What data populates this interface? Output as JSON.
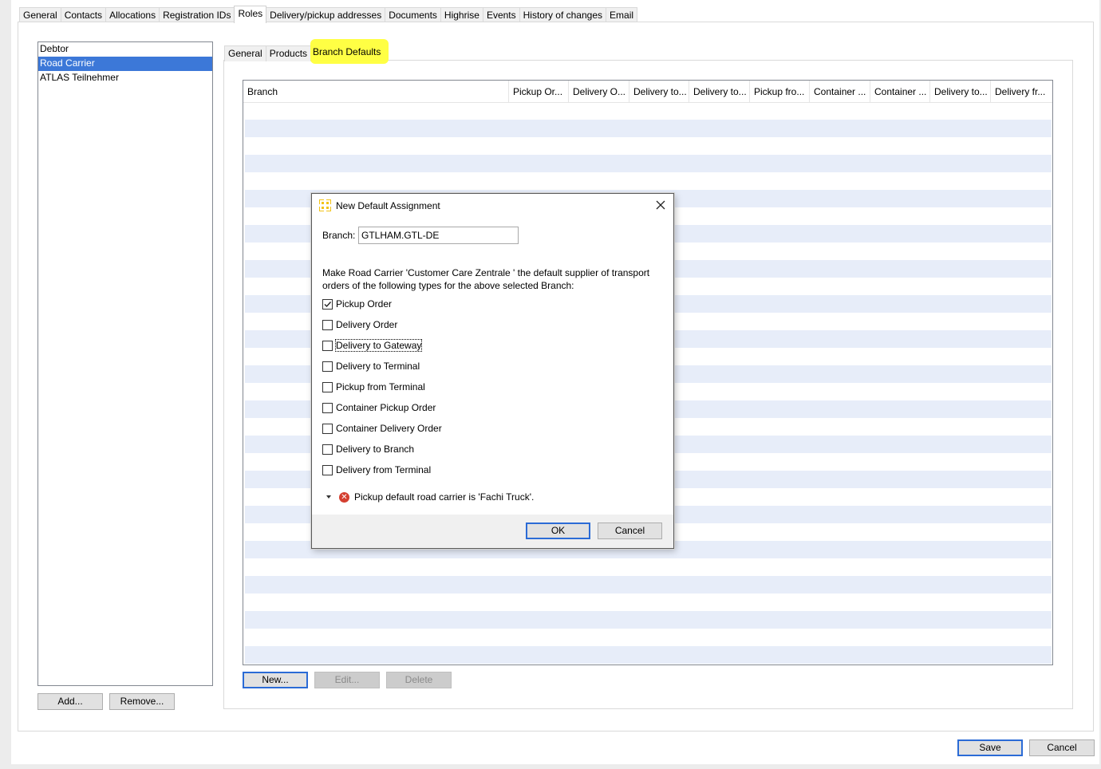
{
  "top_tabs": [
    "General",
    "Contacts",
    "Allocations",
    "Registration IDs",
    "Roles",
    "Delivery/pickup addresses",
    "Documents",
    "Highrise",
    "Events",
    "History of changes",
    "Email"
  ],
  "roles": {
    "items": [
      "Debtor",
      "Road Carrier",
      "ATLAS Teilnehmer"
    ],
    "add_label": "Add...",
    "remove_label": "Remove..."
  },
  "inner_tabs": [
    "General",
    "Products",
    "Branch Defaults"
  ],
  "table": {
    "columns": [
      "Branch",
      "Pickup Or...",
      "Delivery O...",
      "Delivery to...",
      "Delivery to...",
      "Pickup fro...",
      "Container ...",
      "Container ...",
      "Delivery to...",
      "Delivery fr..."
    ],
    "new_label": "New...",
    "edit_label": "Edit...",
    "delete_label": "Delete"
  },
  "dialog": {
    "title": "New Default Assignment",
    "branch_label": "Branch:",
    "branch_value": "GTLHAM.GTL-DE",
    "description": "Make Road Carrier 'Customer Care Zentrale ' the default supplier of transport orders of the following types for the above selected Branch:",
    "options": [
      {
        "label": "Pickup Order",
        "checked": true
      },
      {
        "label": "Delivery Order",
        "checked": false
      },
      {
        "label": "Delivery to Gateway",
        "checked": false
      },
      {
        "label": "Delivery to Terminal",
        "checked": false
      },
      {
        "label": "Pickup from Terminal",
        "checked": false
      },
      {
        "label": "Container Pickup Order",
        "checked": false
      },
      {
        "label": "Container Delivery Order",
        "checked": false
      },
      {
        "label": "Delivery to Branch",
        "checked": false
      },
      {
        "label": "Delivery from Terminal",
        "checked": false
      }
    ],
    "message": "Pickup default road carrier is 'Fachi Truck'.",
    "ok_label": "OK",
    "cancel_label": "Cancel"
  },
  "footer": {
    "save_label": "Save",
    "cancel_label": "Cancel"
  },
  "colors": {
    "selection": "#3c78d8",
    "highlight": "#ffff3a",
    "stripe": "#e7edf9",
    "error": "#d43f30",
    "default_button_border": "#2b6bd6"
  }
}
